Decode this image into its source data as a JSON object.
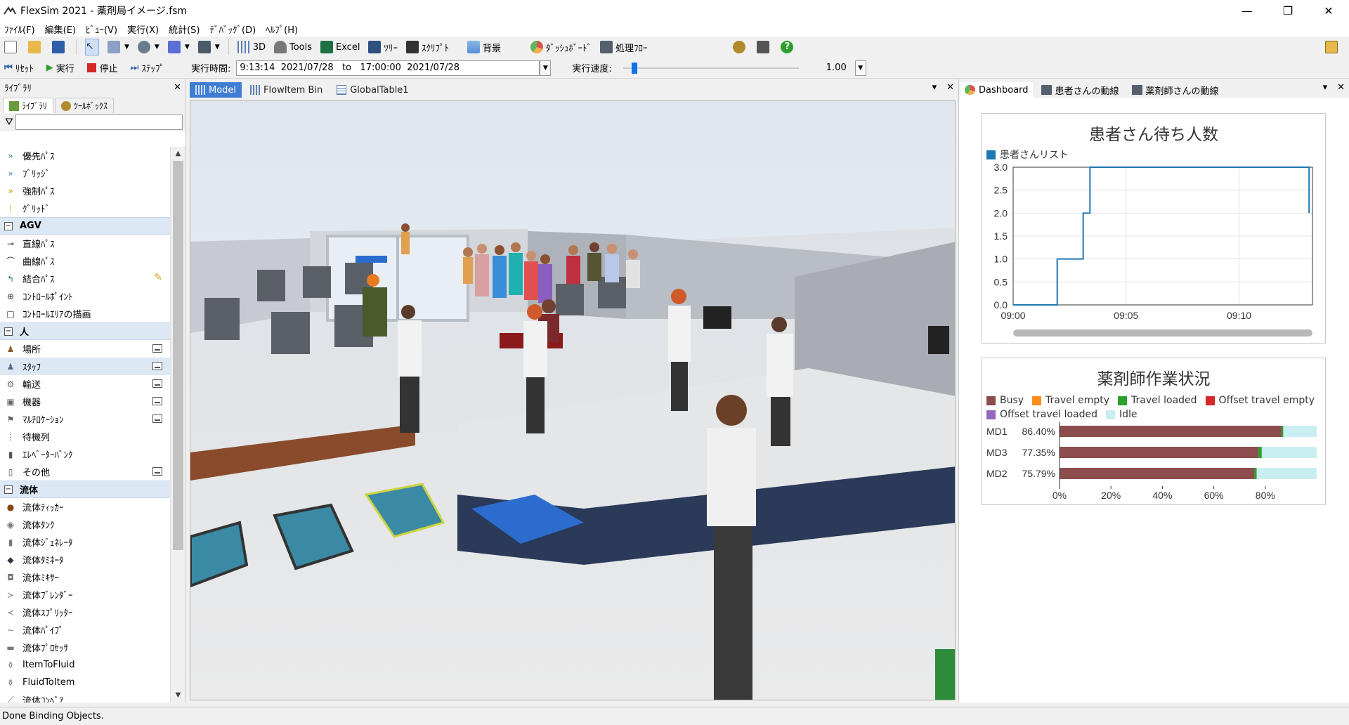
{
  "window": {
    "title": "FlexSim 2021 - 薬剤局イメージ.fsm",
    "minimize": "—",
    "maximize": "❐",
    "close": "✕"
  },
  "menu": [
    "ﾌｧｲﾙ(F)",
    "編集(E)",
    "ﾋﾞｭｰ(V)",
    "実行(X)",
    "統計(S)",
    "ﾃﾞﾊﾞｯｸﾞ(D)",
    "ﾍﾙﾌﾟ(H)"
  ],
  "toolbar": {
    "btn_3d": "3D",
    "btn_tools": "Tools",
    "btn_excel": "Excel",
    "btn_tree": "ﾂﾘｰ",
    "btn_script": "ｽｸﾘﾌﾟﾄ",
    "btn_background": "背景",
    "btn_dashboard": "ﾀﾞｯｼｭﾎﾞｰﾄﾞ",
    "btn_process_flow": "処理ﾌﾛｰ"
  },
  "runbar": {
    "reset": "ﾘｾｯﾄ",
    "run": "実行",
    "stop": "停止",
    "step": "ｽﾃｯﾌﾟ",
    "time_label": "実行時間:",
    "time_value": "9:13:14  2021/07/28   to   17:00:00  2021/07/28",
    "speed_label": "実行速度:",
    "speed_value": "1.00",
    "speed_slider": 0.05
  },
  "library": {
    "title": "ﾗｲﾌﾞﾗﾘ",
    "close": "✕",
    "tab_library": "ﾗｲﾌﾞﾗﾘ",
    "tab_toolbox": "ﾂｰﾙﾎﾞｯｸｽ",
    "filter_placeholder": "",
    "items": [
      {
        "type": "item",
        "label": "優先ﾊﾟｽ",
        "icon": "»",
        "color": "#2e8b57"
      },
      {
        "type": "item",
        "label": "ﾌﾞﾘｯｼﾞ",
        "icon": "»",
        "color": "#4682b4"
      },
      {
        "type": "item",
        "label": "強制ﾊﾟｽ",
        "icon": "»",
        "color": "#cc8800"
      },
      {
        "type": "item",
        "label": "ｸﾞﾘｯﾄﾞ",
        "icon": "⁞",
        "color": "#c9a227"
      },
      {
        "type": "group",
        "label": "AGV"
      },
      {
        "type": "item",
        "label": "直線ﾊﾟｽ",
        "icon": "⊸",
        "color": "#333"
      },
      {
        "type": "item",
        "label": "曲線ﾊﾟｽ",
        "icon": "⌒",
        "color": "#333"
      },
      {
        "type": "item",
        "label": "結合ﾊﾟｽ",
        "icon": "↰",
        "color": "#2e8b57",
        "edit": true
      },
      {
        "type": "item",
        "label": "ｺﾝﾄﾛｰﾙﾎﾟｲﾝﾄ",
        "icon": "⊕",
        "color": "#333"
      },
      {
        "type": "item",
        "label": "ｺﾝﾄﾛｰﾙｴﾘｱの描画",
        "icon": "□",
        "color": "#333"
      },
      {
        "type": "group",
        "label": "人"
      },
      {
        "type": "item",
        "label": "場所",
        "icon": "♟",
        "color": "#8b5a2b",
        "pin": true
      },
      {
        "type": "item",
        "label": "ｽﾀｯﾌ",
        "icon": "♟",
        "color": "#5a6a8b",
        "pin": true,
        "selected": true
      },
      {
        "type": "item",
        "label": "輸送",
        "icon": "⚙",
        "color": "#666",
        "pin": true
      },
      {
        "type": "item",
        "label": "機器",
        "icon": "▣",
        "color": "#666",
        "pin": true
      },
      {
        "type": "item",
        "label": "ﾏﾙﾁﾛｹｰｼｮﾝ",
        "icon": "⚑",
        "color": "#666",
        "pin": true
      },
      {
        "type": "item",
        "label": "待機列",
        "icon": "⋮",
        "color": "#555"
      },
      {
        "type": "item",
        "label": "ｴﾚﾍﾞｰﾀｰﾊﾞﾝｸ",
        "icon": "▮",
        "color": "#555"
      },
      {
        "type": "item",
        "label": "その他",
        "icon": "▯",
        "color": "#555",
        "pin": true
      },
      {
        "type": "group",
        "label": "流体"
      },
      {
        "type": "item",
        "label": "流体ﾃｨｯｶｰ",
        "icon": "●",
        "color": "#8b4513"
      },
      {
        "type": "item",
        "label": "流体ﾀﾝｸ",
        "icon": "◉",
        "color": "#777"
      },
      {
        "type": "item",
        "label": "流体ｼﾞｪﾈﾚｰﾀ",
        "icon": "▮",
        "color": "#777"
      },
      {
        "type": "item",
        "label": "流体ﾀﾐﾈｰﾀ",
        "icon": "◆",
        "color": "#334"
      },
      {
        "type": "item",
        "label": "流体ﾐｷｻｰ",
        "icon": "◘",
        "color": "#777"
      },
      {
        "type": "item",
        "label": "流体ﾌﾞﾚﾝﾀﾞｰ",
        "icon": "≻",
        "color": "#777"
      },
      {
        "type": "item",
        "label": "流体ｽﾌﾟﾘｯﾀｰ",
        "icon": "≺",
        "color": "#777"
      },
      {
        "type": "item",
        "label": "流体ﾊﾟｲﾌﾟ",
        "icon": "∼",
        "color": "#777"
      },
      {
        "type": "item",
        "label": "流体ﾌﾟﾛｾｯｻ",
        "icon": "▬",
        "color": "#777"
      },
      {
        "type": "item",
        "label": "ItemToFluid",
        "icon": "⚱",
        "color": "#777"
      },
      {
        "type": "item",
        "label": "FluidToItem",
        "icon": "⚱",
        "color": "#777"
      },
      {
        "type": "item",
        "label": "流体ｺﾝﾍﾞｱ",
        "icon": "⟋",
        "color": "#556b2f"
      }
    ]
  },
  "model_tabs": [
    "Model",
    "FlowItem Bin",
    "GlobalTable1"
  ],
  "model_ctrls": {
    "menu": "▾",
    "close": "✕"
  },
  "dashboard": {
    "tabs": [
      "Dashboard",
      "患者さんの動線",
      "薬剤師さんの動線"
    ],
    "menu": "▾",
    "close": "✕",
    "waiting_chart": {
      "type": "line",
      "title": "患者さん待ち人数",
      "series": [
        {
          "name": "患者さんリスト",
          "color": "#1f77b4"
        }
      ],
      "step_points": [
        [
          0,
          0
        ],
        [
          3.9,
          0
        ],
        [
          3.9,
          1
        ],
        [
          6.2,
          1
        ],
        [
          6.2,
          2
        ],
        [
          6.8,
          2
        ],
        [
          6.8,
          3
        ],
        [
          26.2,
          3
        ],
        [
          26.2,
          2
        ]
      ],
      "x_domain": [
        0,
        26.5
      ],
      "y_ticks": [
        "0.0",
        "0.5",
        "1.0",
        "1.5",
        "2.0",
        "2.5",
        "3.0"
      ],
      "y_domain": [
        0,
        3
      ],
      "x_ticks": [
        {
          "value": 0,
          "label": "09:00"
        },
        {
          "value": 10,
          "label": "09:05"
        },
        {
          "value": 20,
          "label": "09:10"
        }
      ]
    },
    "pharmacist_chart": {
      "type": "bar",
      "title": "薬剤師作業状況",
      "legend": [
        {
          "name": "Busy",
          "color": "#8b4d4d"
        },
        {
          "name": "Travel empty",
          "color": "#ff8c1a"
        },
        {
          "name": "Travel loaded",
          "color": "#2ca02c"
        },
        {
          "name": "Offset travel empty",
          "color": "#d62728"
        },
        {
          "name": "Offset travel loaded",
          "color": "#9467bd"
        },
        {
          "name": "Idle",
          "color": "#c9eef2"
        }
      ],
      "rows": [
        {
          "name": "MD1",
          "pct": "86.40%",
          "busy": 86.4,
          "travel_loaded": 0.6,
          "idle": 13.0
        },
        {
          "name": "MD3",
          "pct": "77.35%",
          "busy": 77.35,
          "travel_loaded": 1.3,
          "idle": 21.35
        },
        {
          "name": "MD2",
          "pct": "75.79%",
          "busy": 75.79,
          "travel_loaded": 0.9,
          "idle": 23.31
        }
      ],
      "x_ticks": [
        "0%",
        "20%",
        "40%",
        "60%",
        "80%"
      ]
    }
  },
  "status": "Done Binding Objects."
}
